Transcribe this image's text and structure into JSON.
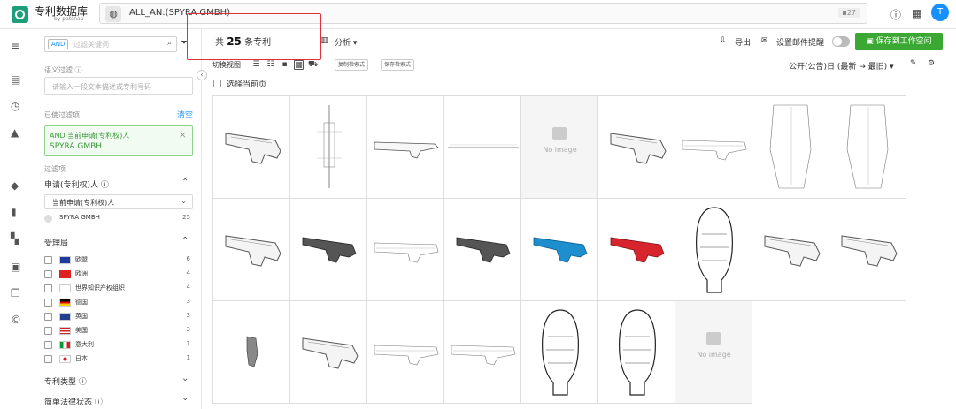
{
  "app": {
    "name": "专利数据库",
    "subtitle": "by patsnap"
  },
  "search": {
    "query": "ALL_AN:(SPYRA GMBH)",
    "count_badge": "▪27"
  },
  "user": {
    "avatar_letter": "T"
  },
  "sidebar": {
    "search_chip": "AND",
    "search_placeholder": "过滤关键词",
    "semantic_label": "语义过滤 ⓘ",
    "semantic_placeholder": "请输入一段文本描述或专利号码",
    "applied_label": "已使过滤项",
    "clear": "清空",
    "applied_line1": "AND 当前申请(专利权)人",
    "applied_line2": "SPYRA GMBH",
    "filter_items_label": "过滤项",
    "applicant_section": "申请(专利权)人 ⓘ",
    "applicant_dropdown": "当前申请(专利权)人",
    "applicant_rows": [
      {
        "label": "SPYRA GMBH",
        "count": "25"
      }
    ],
    "office_section": "受理局",
    "office_rows": [
      {
        "label": "欧盟",
        "count": "6",
        "flag": "eu"
      },
      {
        "label": "欧洲",
        "count": "4",
        "flag": "ep"
      },
      {
        "label": "世界知识产权组织",
        "count": "4",
        "flag": "wipo"
      },
      {
        "label": "德国",
        "count": "3",
        "flag": "de"
      },
      {
        "label": "英国",
        "count": "3",
        "flag": "gb"
      },
      {
        "label": "美国",
        "count": "3",
        "flag": "us"
      },
      {
        "label": "意大利",
        "count": "1",
        "flag": "it"
      },
      {
        "label": "日本",
        "count": "1",
        "flag": "jp"
      }
    ],
    "patent_type_section": "专利类型 ⓘ",
    "legal_status_section": "简单法律状态 ⓘ"
  },
  "toolbar": {
    "count_prefix": "共",
    "count_value": "25",
    "count_suffix": "条专利",
    "analysis": "分析 ▾",
    "export": "导出",
    "email_alert": "设置邮件提醒",
    "save_workspace": "保存到工作空间",
    "switch_view": "切换视图",
    "copy_btn": "复制检索式",
    "save_btn": "保存检索式",
    "sort": "公开(公告)日 (最新 → 最旧) ▾",
    "select_page": "选择当前页"
  },
  "grid": {
    "no_image_text": "No image",
    "cells": [
      "gun",
      "drawing-v",
      "gun-small",
      "line-h",
      "noimg",
      "gun",
      "drawing-h",
      "drawing-tall",
      "drawing-tall",
      "gun",
      "gun-dark",
      "drawing-h",
      "gun-dark",
      "gun-blue",
      "gun-red",
      "oval",
      "gun",
      "gun",
      "gun-tiny",
      "gun",
      "drawing-h",
      "drawing-h",
      "oval",
      "oval",
      "noimg"
    ]
  },
  "colors": {
    "accent": "#1890ff",
    "green": "#3aa832",
    "highlight": "#e0313a"
  }
}
